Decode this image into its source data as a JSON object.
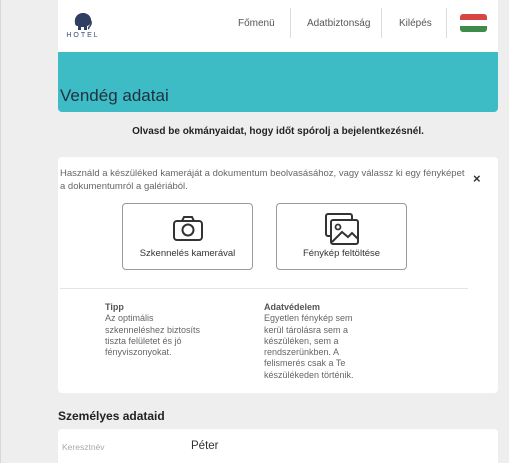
{
  "header": {
    "logo_text": "HOTEL",
    "nav": [
      "Főmenü",
      "Adatbiztonság",
      "Kilépés"
    ],
    "flag_colors": [
      "#d64444",
      "#ffffff",
      "#3e8b4a"
    ]
  },
  "banner": {
    "title": "Vendég adatai",
    "color": "#3dbcc5"
  },
  "instruction": "Olvasd be okmányaidat, hogy időt spórolj a bejelentkezésnél.",
  "scan_card": {
    "description": "Használd a készüléked kameráját a dokumentum beolvasásához, vagy válassz ki egy fényképet a dokumentumról a galériából.",
    "close_label": "×",
    "camera_button": "Szkennelés kamerával",
    "upload_button": "Fénykép feltöltése",
    "tip_title": "Tipp",
    "tip_text": "Az optimális szkenneléshez biztosíts tiszta felületet és jó fényviszonyokat.",
    "privacy_title": "Adatvédelem",
    "privacy_text": "Egyetlen fénykép sem kerül tárolásra sem a készüléken, sem a rendszerünkben. A felismerés csak a Te készülékeden történik."
  },
  "personal": {
    "section_title": "Személyes adataid",
    "first_name_label": "Keresztnév",
    "first_name_value": "Péter"
  }
}
